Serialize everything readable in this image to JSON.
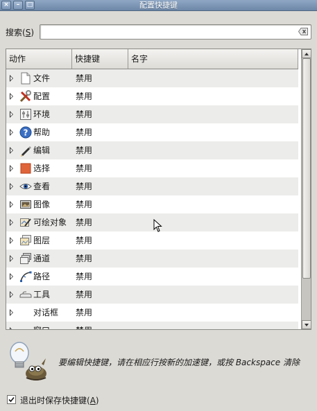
{
  "window": {
    "title": "配置快捷键",
    "close_glyph": "×",
    "minimize_glyph": "–",
    "maximize_glyph": "□"
  },
  "search": {
    "label_prefix": "搜索(",
    "label_mnemonic": "S",
    "label_suffix": ")",
    "value": "",
    "placeholder": ""
  },
  "tree": {
    "columns": [
      "动作",
      "快捷键",
      "名字"
    ],
    "rows": [
      {
        "name": "文件",
        "key": "禁用",
        "icon": "document-icon"
      },
      {
        "name": "配置",
        "key": "禁用",
        "icon": "tools-icon"
      },
      {
        "name": "环境",
        "key": "禁用",
        "icon": "environment-icon"
      },
      {
        "name": "帮助",
        "key": "禁用",
        "icon": "help-icon"
      },
      {
        "name": "编辑",
        "key": "禁用",
        "icon": "pencil-icon"
      },
      {
        "name": "选择",
        "key": "禁用",
        "icon": "selection-icon"
      },
      {
        "name": "查看",
        "key": "禁用",
        "icon": "eye-icon"
      },
      {
        "name": "图像",
        "key": "禁用",
        "icon": "image-icon"
      },
      {
        "name": "可绘对象",
        "key": "禁用",
        "icon": "drawable-icon"
      },
      {
        "name": "图层",
        "key": "禁用",
        "icon": "layers-icon"
      },
      {
        "name": "通道",
        "key": "禁用",
        "icon": "channels-icon"
      },
      {
        "name": "路径",
        "key": "禁用",
        "icon": "paths-icon"
      },
      {
        "name": "工具",
        "key": "禁用",
        "icon": "tool-icon"
      },
      {
        "name": "对话框",
        "key": "禁用",
        "icon": ""
      },
      {
        "name": "窗口",
        "key": "禁用",
        "icon": ""
      }
    ]
  },
  "hint": {
    "icon": "wilber-lightbulb-icon",
    "text": "要编辑快捷键，请在相应行按新的加速键，或按 Backspace 清除"
  },
  "save_on_exit": {
    "checked": true,
    "label_prefix": "退出时保存快捷键(",
    "label_mnemonic": "A",
    "label_suffix": ")"
  },
  "colors": {
    "titlebar": "#7b93b3",
    "background": "#dcdad5",
    "row_alt": "#ececea"
  }
}
